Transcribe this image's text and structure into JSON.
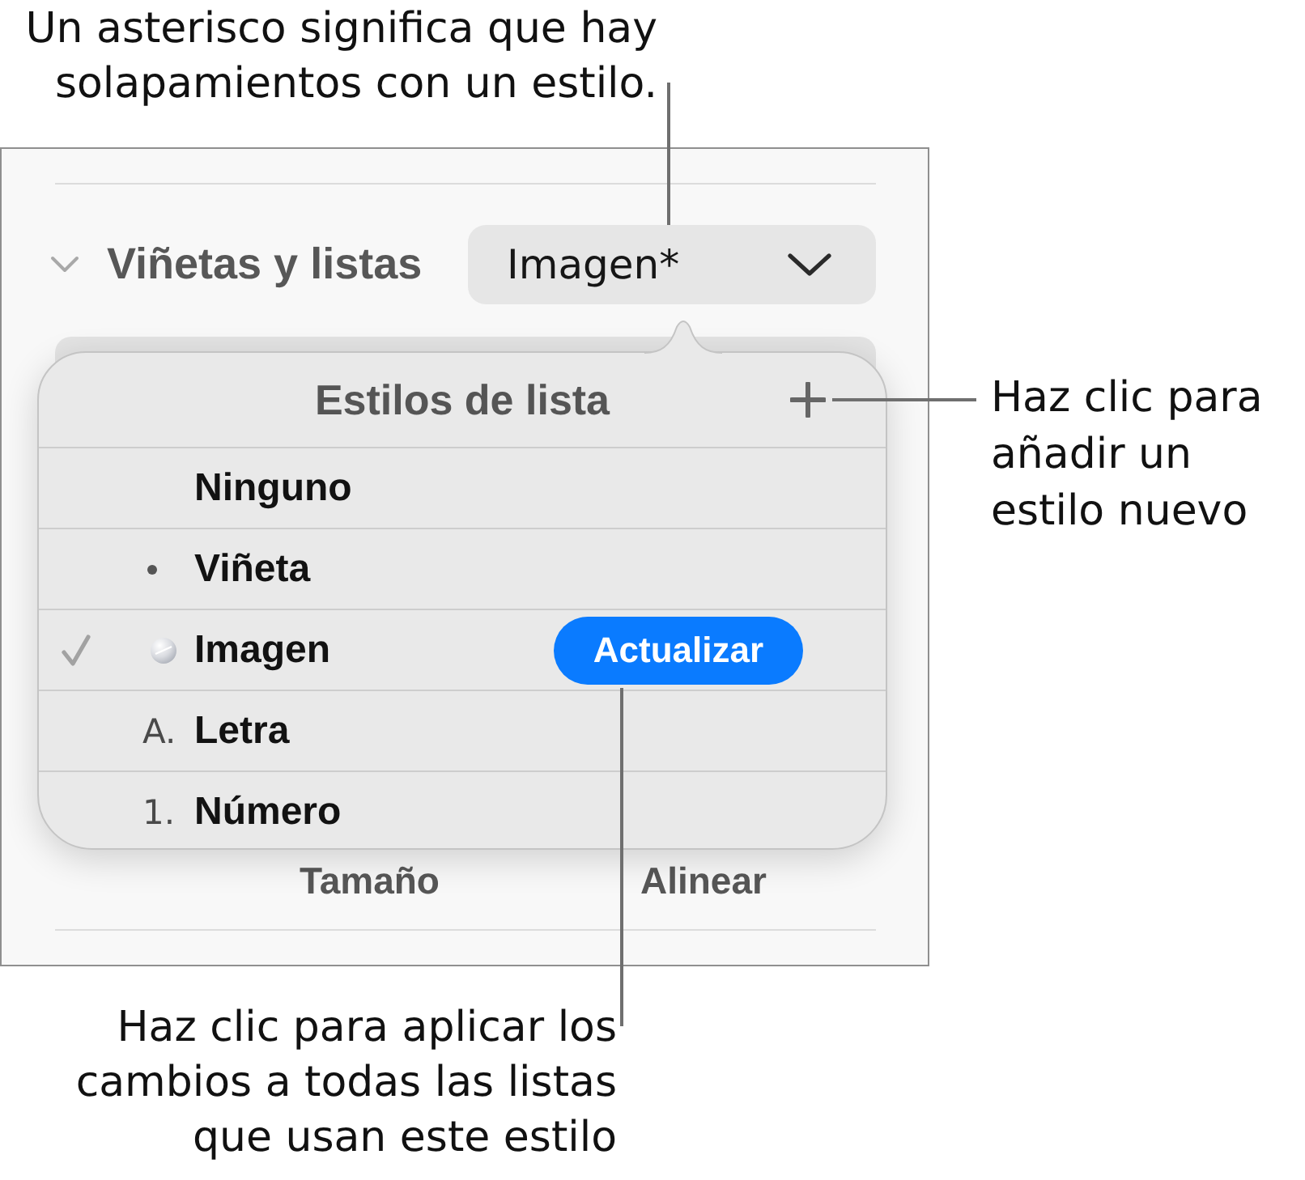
{
  "callouts": [
    {
      "lines": [
        "Un asterisco significa que hay",
        "solapamientos con un estilo."
      ]
    },
    {
      "lines": [
        "Haz clic para",
        "añadir un",
        "estilo nuevo"
      ]
    },
    {
      "lines": [
        "Haz clic para aplicar los",
        "cambios a todas las listas",
        "que usan este estilo"
      ]
    }
  ],
  "panel": {
    "section": {
      "title": "Viñetas y listas",
      "expanded": true
    },
    "style_popup": {
      "value": "Imagen*"
    },
    "popover": {
      "title": "Estilos de lista",
      "styles": [
        {
          "kind": "none",
          "label": "Ninguno",
          "selected": false
        },
        {
          "kind": "bullet",
          "label": "Viñeta",
          "selected": false
        },
        {
          "kind": "image",
          "label": "Imagen",
          "selected": true,
          "action": "Actualizar"
        },
        {
          "kind": "letter",
          "marker": "A.",
          "label": "Letra",
          "selected": false
        },
        {
          "kind": "number",
          "marker": "1.",
          "label": "Número",
          "selected": false
        }
      ]
    },
    "field_labels": [
      "Tamaño",
      "Alinear"
    ]
  }
}
